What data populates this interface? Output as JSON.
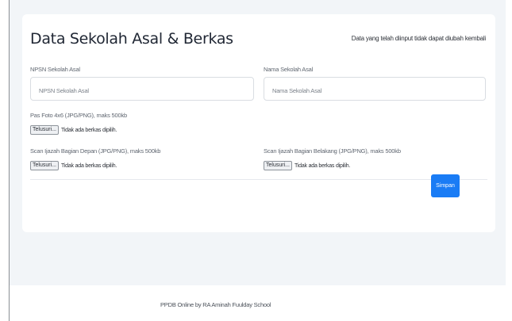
{
  "card": {
    "title": "Data Sekolah Asal & Berkas",
    "note": "Data yang telah diinput tidak dapat diubah kembali"
  },
  "fields": {
    "npsn": {
      "label": "NPSN Sekolah Asal",
      "placeholder": "NPSN Sekolah Asal",
      "value": ""
    },
    "school_name": {
      "label": "Nama Sekolah Asal",
      "placeholder": "Nama Sekolah Asal",
      "value": ""
    }
  },
  "files": {
    "photo": {
      "label": "Pas Foto 4x6 (JPG/PNG), maks 500kb",
      "button": "Telusuri...",
      "status": "Tidak ada berkas dipilih."
    },
    "ijazah_front": {
      "label": "Scan Ijazah Bagian Depan (JPG/PNG), maks 500kb",
      "button": "Telusuri...",
      "status": "Tidak ada berkas dipilih."
    },
    "ijazah_back": {
      "label": "Scan Ijazah Bagian Belakang (JPG/PNG), maks 500kb",
      "button": "Telusuri...",
      "status": "Tidak ada berkas dipilih."
    }
  },
  "actions": {
    "save_label": "Simpan"
  },
  "footer": {
    "text": "PPDB Online by RA Aminah Fuulday School"
  },
  "colors": {
    "primary": "#1a7cf5",
    "background": "#f2f5f8",
    "card": "#ffffff"
  }
}
